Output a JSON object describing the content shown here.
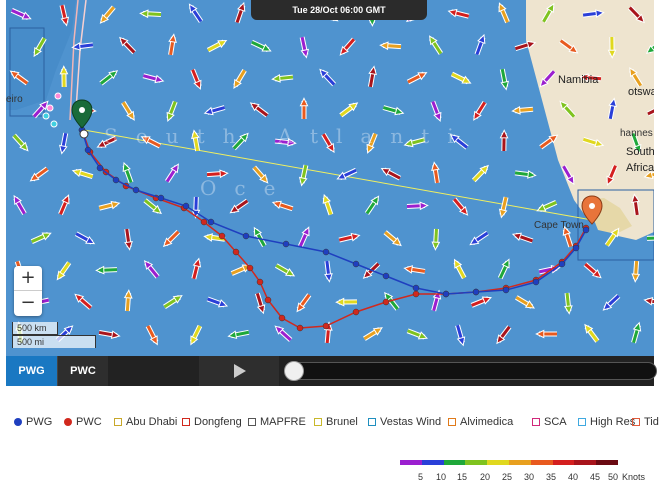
{
  "map": {
    "date_banner": "Tue 28/Oct 06:00 GMT",
    "ocean_label_1": "South Atlanti",
    "ocean_label_2": "Oce",
    "places": [
      {
        "text": "Namibia"
      },
      {
        "text": "otswa"
      },
      {
        "text": "hannes"
      },
      {
        "text": "South"
      },
      {
        "text": "Africa"
      },
      {
        "text": "Cape Town"
      },
      {
        "text": "eiro"
      }
    ],
    "zoom_in": "+",
    "zoom_out": "−",
    "scale_km": "500 km",
    "scale_mi": "500 mi",
    "ocean_color": "#4f93cf",
    "land_color": "#eee4cf"
  },
  "controls": {
    "tabs": [
      {
        "label": "PWG",
        "active": true
      },
      {
        "label": "PWC",
        "active": false
      }
    ],
    "play_icon": "play-icon",
    "timeline_progress": 0.0
  },
  "legend": {
    "items": [
      {
        "label": "PWG",
        "marker": "dot",
        "color": "#1f3fbf"
      },
      {
        "label": "PWC",
        "marker": "dot",
        "color": "#d1281d"
      },
      {
        "label": "Abu Dhabi",
        "marker": "square",
        "color": "#c8a82a"
      },
      {
        "label": "Dongfeng",
        "marker": "square",
        "color": "#d1281d"
      },
      {
        "label": "MAPFRE",
        "marker": "square",
        "color": "#555555"
      },
      {
        "label": "Brunel",
        "marker": "square",
        "color": "#c8b82a"
      },
      {
        "label": "Vestas Wind",
        "marker": "square",
        "color": "#1f8fbf"
      },
      {
        "label": "Alvimedica",
        "marker": "square",
        "color": "#e07a1a"
      },
      {
        "label": "SCA",
        "marker": "square",
        "color": "#d1287a"
      },
      {
        "label": "High Res",
        "marker": "square",
        "color": "#3fa9e0"
      },
      {
        "label": "Tid",
        "marker": "square",
        "color": "#e05a3a"
      }
    ]
  },
  "wind_scale": {
    "labels": [
      "5",
      "10",
      "15",
      "20",
      "25",
      "30",
      "35",
      "40",
      "45",
      "50",
      "Knots"
    ],
    "colors": [
      "#9b1fcf",
      "#2a3fd8",
      "#1fa83a",
      "#7fc31f",
      "#e0d81f",
      "#e8a01f",
      "#e85a1f",
      "#d41f1f",
      "#a8141c",
      "#6a0a12"
    ]
  }
}
